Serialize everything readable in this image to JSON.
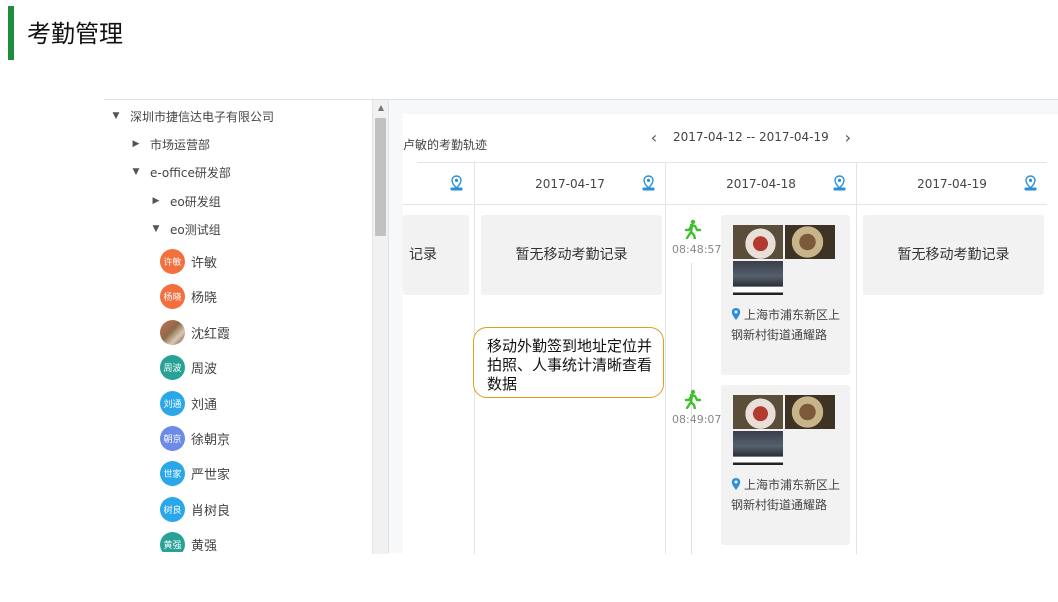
{
  "page": {
    "title": "考勤管理"
  },
  "tree": {
    "company": "深圳市捷信达电子有限公司",
    "dept1": "市场运营部",
    "dept2": "e-office研发部",
    "group1": "eo研发组",
    "group2": "eo测试组",
    "people": [
      {
        "name": "许敏",
        "avatar_text": "许敏",
        "color": "#f26f3e"
      },
      {
        "name": "杨晓",
        "avatar_text": "杨晓",
        "color": "#f26f3e"
      },
      {
        "name": "沈红霞",
        "avatar_text": "",
        "color": "photo"
      },
      {
        "name": "周波",
        "avatar_text": "周波",
        "color": "#28a197"
      },
      {
        "name": "刘通",
        "avatar_text": "刘通",
        "color": "#2aa7e8"
      },
      {
        "name": "徐朝京",
        "avatar_text": "朝京",
        "color": "#6c8be8"
      },
      {
        "name": "严世家",
        "avatar_text": "世家",
        "color": "#2aa7e8"
      },
      {
        "name": "肖树良",
        "avatar_text": "树良",
        "color": "#2aa7e8"
      },
      {
        "name": "黄强",
        "avatar_text": "黄强",
        "color": "#28a197"
      }
    ]
  },
  "track": {
    "title": "卢敏的考勤轨迹",
    "range": "2017-04-12 -- 2017-04-19",
    "columns": [
      {
        "date": "",
        "empty_text": "记录"
      },
      {
        "date": "2017-04-17",
        "empty_text": "暂无移动考勤记录"
      },
      {
        "date": "2017-04-18",
        "empty_text": ""
      },
      {
        "date": "2017-04-19",
        "empty_text": "暂无移动考勤记录"
      }
    ],
    "records": [
      {
        "time": "08:48:57",
        "address": "上海市浦东新区上钢新村街道通耀路"
      },
      {
        "time": "08:49:07",
        "address": "上海市浦东新区上钢新村街道通耀路"
      }
    ]
  },
  "callout": {
    "text": "移动外勤签到地址定位并拍照、人事统计清晰查看数据"
  },
  "colors": {
    "accent": "#1e8e3e",
    "walker": "#3fbf2f",
    "map_icon": "#2a8fd8",
    "callout_border": "#e39b1c"
  }
}
